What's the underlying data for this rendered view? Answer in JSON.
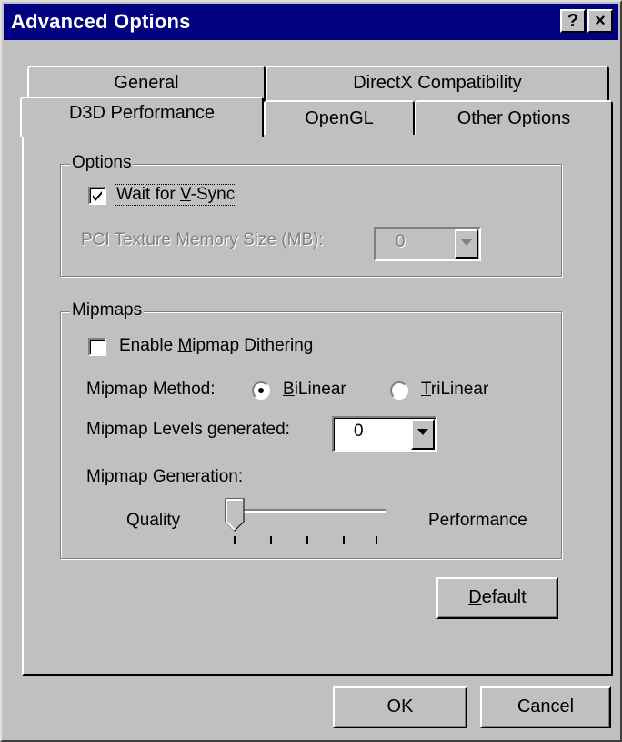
{
  "window": {
    "title": "Advanced Options"
  },
  "titlebar_buttons": {
    "help": "?",
    "close": "×"
  },
  "tabs": {
    "row_back": [
      "General",
      "DirectX Compatibility"
    ],
    "row_front": [
      "D3D Performance",
      "OpenGL",
      "Other Options"
    ],
    "active": "D3D Performance"
  },
  "options_group": {
    "label": "Options",
    "vsync": {
      "pre": "Wait for ",
      "mnemonic": "V",
      "post": "-Sync",
      "checked": true
    },
    "pci_label": "PCI Texture Memory Size (MB):",
    "pci_value": "0"
  },
  "mipmaps_group": {
    "label": "Mipmaps",
    "dither": {
      "pre": "Enable ",
      "mnemonic": "M",
      "post": "ipmap Dithering",
      "checked": false
    },
    "method_label": "Mipmap Method:",
    "bilinear": {
      "mnemonic": "B",
      "post": "iLinear",
      "selected": true
    },
    "trilinear": {
      "mnemonic": "T",
      "post": "riLinear",
      "selected": false
    },
    "levels_label": "Mipmap Levels generated:",
    "levels_value": "0",
    "generation_label": "Mipmap Generation:",
    "slider": {
      "left": "Quality",
      "right": "Performance",
      "position": 0,
      "ticks": 5
    }
  },
  "buttons": {
    "default": {
      "mnemonic": "D",
      "post": "efault"
    },
    "ok": "OK",
    "cancel": "Cancel"
  }
}
